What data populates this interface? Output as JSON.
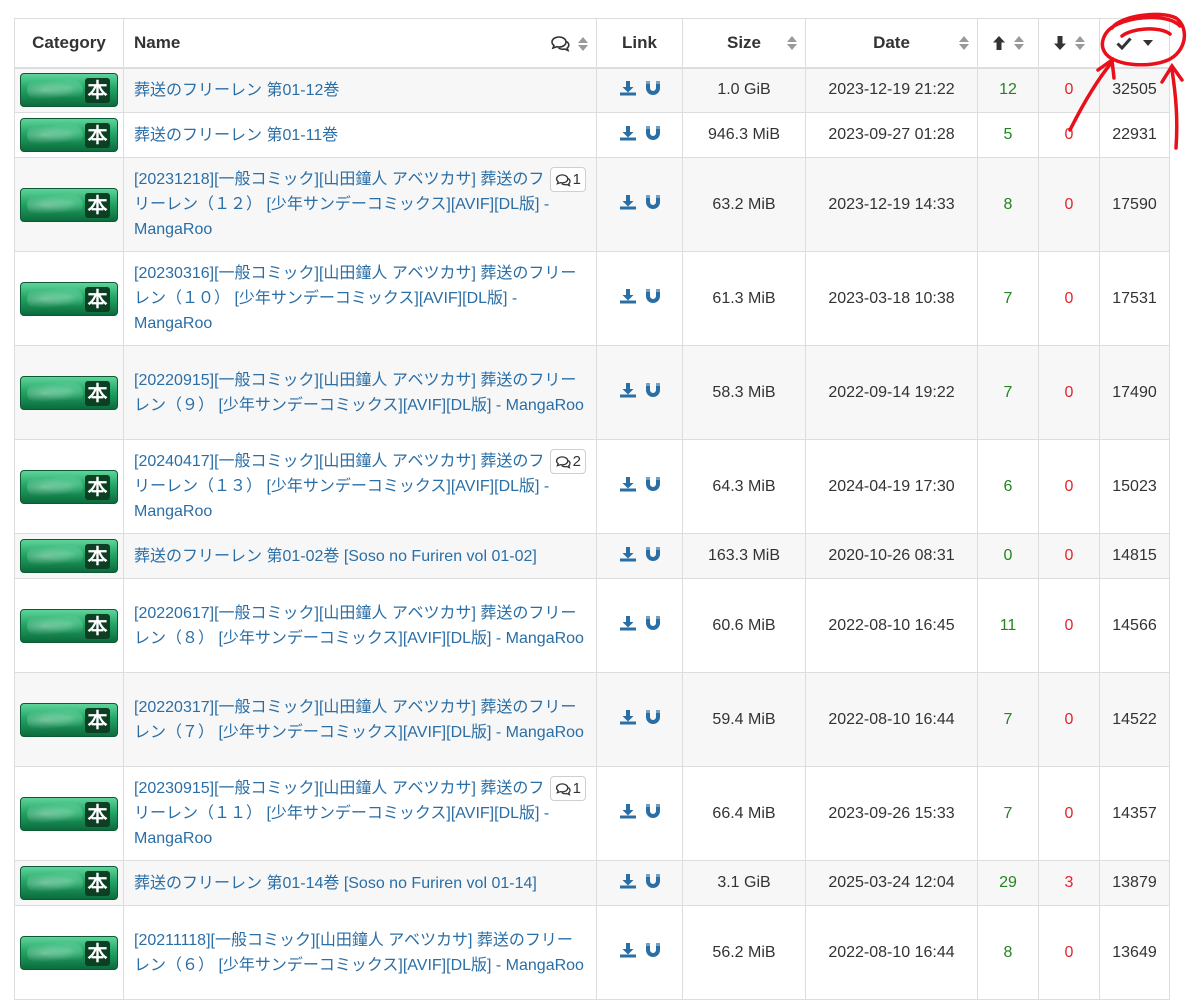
{
  "header": {
    "category": "Category",
    "name": "Name",
    "link": "Link",
    "size": "Size",
    "date": "Date",
    "seeders_icon": "arrow-up-icon",
    "leechers_icon": "arrow-down-icon",
    "completed_icon": "checkmark-icon",
    "comments_icon": "comments-icon"
  },
  "category_badge": {
    "kanji": "本",
    "colors": [
      "#5fd49a",
      "#22a565",
      "#0c6b3c"
    ]
  },
  "colors": {
    "link": "#2a6ea6",
    "seeders": "#23851f",
    "leechers": "#e3252b",
    "annotation": "#e8101a"
  },
  "rows": [
    {
      "title": "葬送のフリーレン 第01-12巻",
      "comments": null,
      "size": "1.0 GiB",
      "date": "2023-12-19 21:22",
      "seeders": "12",
      "leechers": "0",
      "completed": "32505"
    },
    {
      "title": "葬送のフリーレン 第01-11巻",
      "comments": null,
      "size": "946.3 MiB",
      "date": "2023-09-27 01:28",
      "seeders": "5",
      "leechers": "0",
      "completed": "22931"
    },
    {
      "title": "[20231218][一般コミック][山田鐘人 アベツカサ] 葬送のフリーレン（１２） [少年サンデーコミックス][AVIF][DL版] - MangaRoo",
      "comments": "1",
      "size": "63.2 MiB",
      "date": "2023-12-19 14:33",
      "seeders": "8",
      "leechers": "0",
      "completed": "17590"
    },
    {
      "title": "[20230316][一般コミック][山田鐘人 アベツカサ] 葬送のフリーレン（１０） [少年サンデーコミックス][AVIF][DL版] - MangaRoo",
      "comments": null,
      "size": "61.3 MiB",
      "date": "2023-03-18 10:38",
      "seeders": "7",
      "leechers": "0",
      "completed": "17531"
    },
    {
      "title": "[20220915][一般コミック][山田鐘人 アベツカサ] 葬送のフリーレン（９） [少年サンデーコミックス][AVIF][DL版] - MangaRoo",
      "comments": null,
      "size": "58.3 MiB",
      "date": "2022-09-14 19:22",
      "seeders": "7",
      "leechers": "0",
      "completed": "17490"
    },
    {
      "title": "[20240417][一般コミック][山田鐘人 アベツカサ] 葬送のフリーレン（１３） [少年サンデーコミックス][AVIF][DL版] - MangaRoo",
      "comments": "2",
      "size": "64.3 MiB",
      "date": "2024-04-19 17:30",
      "seeders": "6",
      "leechers": "0",
      "completed": "15023"
    },
    {
      "title": "葬送のフリーレン 第01-02巻 [Soso no Furiren vol 01-02]",
      "comments": null,
      "size": "163.3 MiB",
      "date": "2020-10-26 08:31",
      "seeders": "0",
      "leechers": "0",
      "completed": "14815"
    },
    {
      "title": "[20220617][一般コミック][山田鐘人 アベツカサ] 葬送のフリーレン（８） [少年サンデーコミックス][AVIF][DL版] - MangaRoo",
      "comments": null,
      "size": "60.6 MiB",
      "date": "2022-08-10 16:45",
      "seeders": "11",
      "leechers": "0",
      "completed": "14566"
    },
    {
      "title": "[20220317][一般コミック][山田鐘人 アベツカサ] 葬送のフリーレン（７） [少年サンデーコミックス][AVIF][DL版] - MangaRoo",
      "comments": null,
      "size": "59.4 MiB",
      "date": "2022-08-10 16:44",
      "seeders": "7",
      "leechers": "0",
      "completed": "14522"
    },
    {
      "title": "[20230915][一般コミック][山田鐘人 アベツカサ] 葬送のフリーレン（１１） [少年サンデーコミックス][AVIF][DL版] - MangaRoo",
      "comments": "1",
      "size": "66.4 MiB",
      "date": "2023-09-26 15:33",
      "seeders": "7",
      "leechers": "0",
      "completed": "14357"
    },
    {
      "title": "葬送のフリーレン 第01-14巻 [Soso no Furiren vol 01-14]",
      "comments": null,
      "size": "3.1 GiB",
      "date": "2025-03-24 12:04",
      "seeders": "29",
      "leechers": "3",
      "completed": "13879"
    },
    {
      "title": "[20211118][一般コミック][山田鐘人 アベツカサ] 葬送のフリーレン（６） [少年サンデーコミックス][AVIF][DL版] - MangaRoo",
      "comments": null,
      "size": "56.2 MiB",
      "date": "2022-08-10 16:44",
      "seeders": "8",
      "leechers": "0",
      "completed": "13649"
    }
  ]
}
